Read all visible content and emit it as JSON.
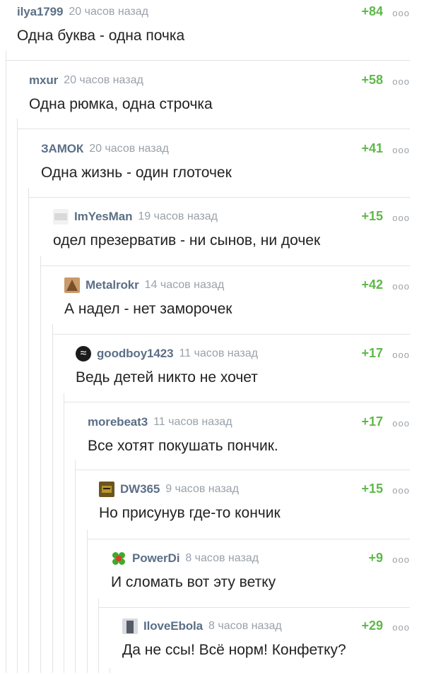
{
  "more_glyph": "ooo",
  "comments": [
    {
      "user": "ilya1799",
      "time": "20 часов назад",
      "rating": "+84",
      "text": "Одна буква - одна почка",
      "avatar": null
    },
    {
      "user": "mxur",
      "time": "20 часов назад",
      "rating": "+58",
      "text": "Одна рюмка, одна строчка",
      "avatar": null
    },
    {
      "user": "ЗАМОК",
      "time": "20 часов назад",
      "rating": "+41",
      "text": "Одна жизнь - один глоточек",
      "avatar": null
    },
    {
      "user": "ImYesMan",
      "time": "19 часов назад",
      "rating": "+15",
      "text": "одел презерватив - ни сынов, ни дочек",
      "avatar": "blank-avatar-icon"
    },
    {
      "user": "Metalrokr",
      "time": "14 часов назад",
      "rating": "+42",
      "text": "А надел - нет заморочек",
      "avatar": "cat-avatar-icon"
    },
    {
      "user": "goodboy1423",
      "time": "11 часов назад",
      "rating": "+17",
      "text": "Ведь детей никто не хочет",
      "avatar": "wave-logo-avatar-icon"
    },
    {
      "user": "morebeat3",
      "time": "11 часов назад",
      "rating": "+17",
      "text": "Все хотят покушать пончик.",
      "avatar": null
    },
    {
      "user": "DW365",
      "time": "9 часов назад",
      "rating": "+15",
      "text": "Но присунув где-то кончик",
      "avatar": "face-avatar-icon"
    },
    {
      "user": "PowerDi",
      "time": "8 часов назад",
      "rating": "+9",
      "text": "И сломать вот эту ветку",
      "avatar": "flower-avatar-icon"
    },
    {
      "user": "IloveEbola",
      "time": "8 часов назад",
      "rating": "+29",
      "text": "Да не ссы! Всё норм! Конфетку?",
      "avatar": "portrait-avatar-icon"
    }
  ]
}
